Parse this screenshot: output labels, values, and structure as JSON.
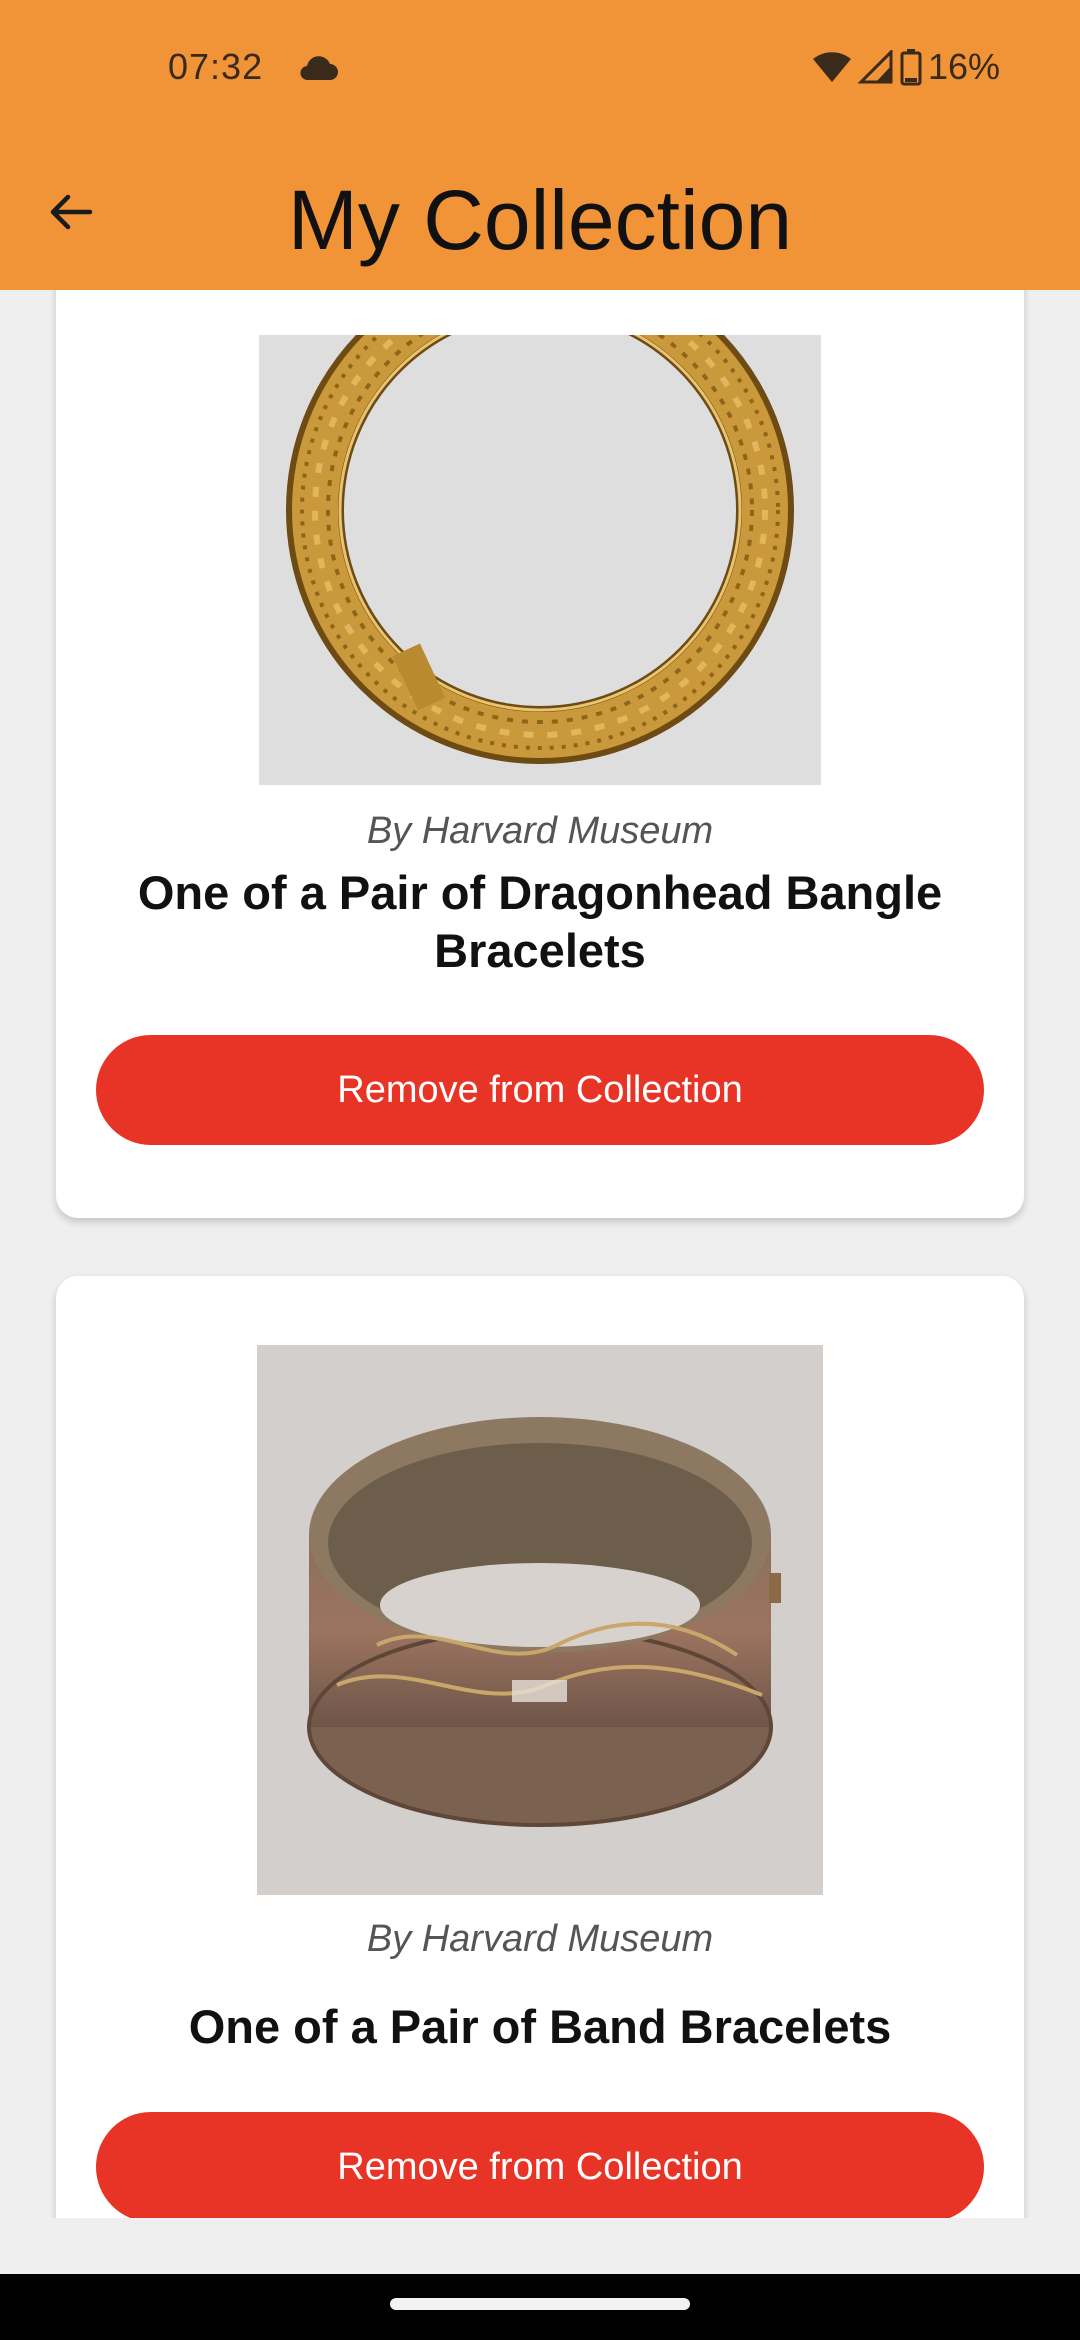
{
  "status_bar": {
    "time": "07:32",
    "battery": "16%",
    "icons": [
      "cloud-icon",
      "wifi-icon",
      "signal-icon",
      "battery-icon"
    ]
  },
  "app_bar": {
    "title": "My Collection",
    "back_icon": "arrow-back-icon"
  },
  "colors": {
    "app_bar": "#f19438",
    "button": "#e83427",
    "background": "#efefef",
    "card": "#ffffff"
  },
  "items": [
    {
      "byline": "By Harvard Museum",
      "title": "One of a Pair of Dragonhead Bangle Bracelets",
      "button_label": "Remove from Collection"
    },
    {
      "byline": "By Harvard Museum",
      "title": "One of a Pair of Band Bracelets",
      "button_label": "Remove from Collection"
    }
  ]
}
